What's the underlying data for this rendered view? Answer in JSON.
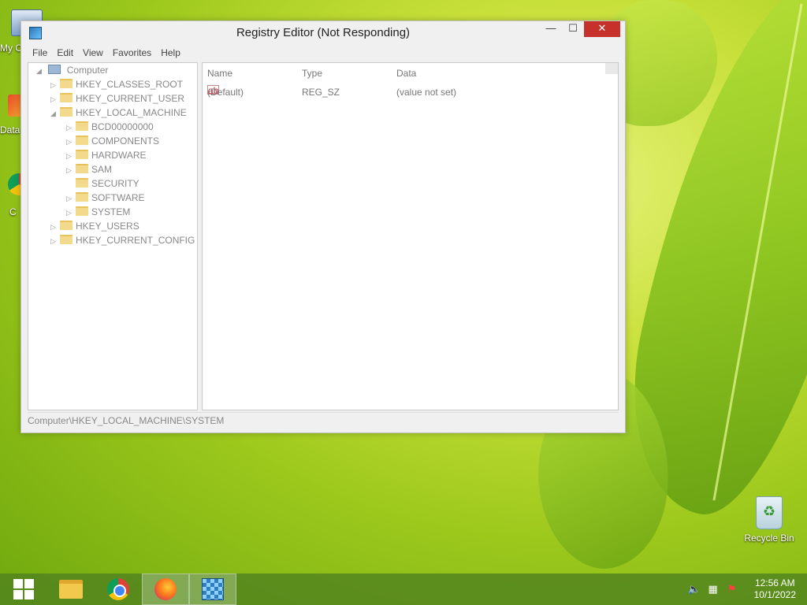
{
  "desktop": {
    "left_icon_1_label": "My C",
    "left_icon_2_label": "Data",
    "left_icon_3_label": "C",
    "recycle_bin_label": "Recycle Bin"
  },
  "window": {
    "title": "Registry Editor (Not Responding)",
    "controls": {
      "minimize": "—",
      "maximize": "☐",
      "close": "✕"
    },
    "menu": [
      "File",
      "Edit",
      "View",
      "Favorites",
      "Help"
    ]
  },
  "tree": {
    "root": "Computer",
    "items": [
      {
        "label": "HKEY_CLASSES_ROOT",
        "level": 1,
        "arrow": "▷"
      },
      {
        "label": "HKEY_CURRENT_USER",
        "level": 1,
        "arrow": "▷"
      },
      {
        "label": "HKEY_LOCAL_MACHINE",
        "level": 1,
        "arrow": "◢"
      },
      {
        "label": "BCD00000000",
        "level": 2,
        "arrow": "▷"
      },
      {
        "label": "COMPONENTS",
        "level": 2,
        "arrow": "▷"
      },
      {
        "label": "HARDWARE",
        "level": 2,
        "arrow": "▷"
      },
      {
        "label": "SAM",
        "level": 2,
        "arrow": "▷"
      },
      {
        "label": "SECURITY",
        "level": 2,
        "arrow": ""
      },
      {
        "label": "SOFTWARE",
        "level": 2,
        "arrow": "▷"
      },
      {
        "label": "SYSTEM",
        "level": 2,
        "arrow": "▷"
      },
      {
        "label": "HKEY_USERS",
        "level": 1,
        "arrow": "▷"
      },
      {
        "label": "HKEY_CURRENT_CONFIG",
        "level": 1,
        "arrow": "▷"
      }
    ]
  },
  "list": {
    "columns": [
      "Name",
      "Type",
      "Data"
    ],
    "rows": [
      {
        "name": "(Default)",
        "type": "REG_SZ",
        "data": "(value not set)",
        "icon": "ab"
      }
    ]
  },
  "status": {
    "path": "Computer\\HKEY_LOCAL_MACHINE\\SYSTEM"
  },
  "taskbar": {
    "apps": [
      "start-button",
      "file-explorer",
      "chrome",
      "firefox",
      "registry-editor"
    ],
    "time": "12:56 AM",
    "date": "10/1/2022"
  }
}
